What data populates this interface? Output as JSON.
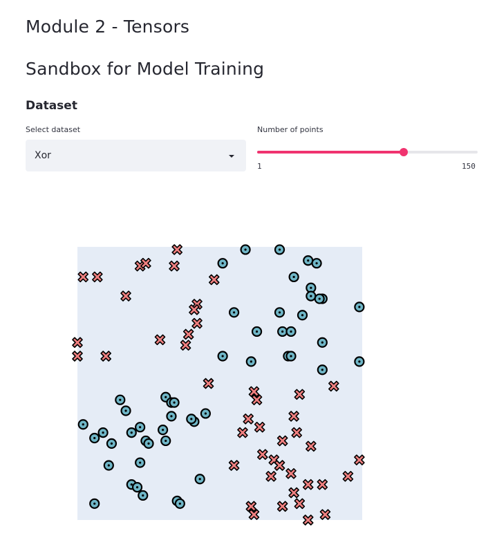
{
  "page": {
    "title": "Module 2 - Tensors",
    "subtitle": "Sandbox for Model Training",
    "section": "Dataset"
  },
  "dataset_select": {
    "label": "Select dataset",
    "value": "Xor"
  },
  "points_slider": {
    "label": "Number of points",
    "min": 1,
    "max": 150,
    "value": 100,
    "min_label": "1",
    "max_label": "150"
  },
  "colors": {
    "accent": "#f0336f",
    "class_cross": "#f08080",
    "class_circle": "#6fb6c7",
    "plot_bg": "#e5ecf6"
  },
  "chart_data": {
    "type": "scatter",
    "title": "",
    "xlabel": "",
    "ylabel": "",
    "xlim": [
      0,
      1
    ],
    "ylim": [
      0,
      1
    ],
    "grid": false,
    "series": [
      {
        "marker": "x",
        "color": "#f08080",
        "points": [
          [
            0.35,
            0.99
          ],
          [
            0.22,
            0.93
          ],
          [
            0.24,
            0.94
          ],
          [
            0.34,
            0.93
          ],
          [
            0.02,
            0.89
          ],
          [
            0.07,
            0.89
          ],
          [
            0.48,
            0.88
          ],
          [
            0.17,
            0.82
          ],
          [
            0.42,
            0.79
          ],
          [
            0.41,
            0.77
          ],
          [
            0.42,
            0.72
          ],
          [
            0.39,
            0.68
          ],
          [
            0.29,
            0.66
          ],
          [
            0.0,
            0.65
          ],
          [
            0.38,
            0.64
          ],
          [
            0.0,
            0.6
          ],
          [
            0.1,
            0.6
          ],
          [
            0.46,
            0.5
          ],
          [
            0.62,
            0.47
          ],
          [
            0.78,
            0.46
          ],
          [
            0.9,
            0.49
          ],
          [
            0.63,
            0.44
          ],
          [
            0.6,
            0.37
          ],
          [
            0.76,
            0.38
          ],
          [
            0.64,
            0.34
          ],
          [
            0.58,
            0.32
          ],
          [
            0.77,
            0.32
          ],
          [
            0.72,
            0.29
          ],
          [
            0.82,
            0.27
          ],
          [
            0.65,
            0.24
          ],
          [
            0.69,
            0.22
          ],
          [
            0.71,
            0.2
          ],
          [
            0.55,
            0.2
          ],
          [
            0.75,
            0.17
          ],
          [
            0.68,
            0.16
          ],
          [
            0.99,
            0.22
          ],
          [
            0.95,
            0.16
          ],
          [
            0.81,
            0.13
          ],
          [
            0.86,
            0.13
          ],
          [
            0.76,
            0.1
          ],
          [
            0.78,
            0.06
          ],
          [
            0.61,
            0.05
          ],
          [
            0.72,
            0.05
          ],
          [
            0.62,
            0.02
          ],
          [
            0.87,
            0.02
          ],
          [
            0.81,
            0.0
          ]
        ]
      },
      {
        "marker": "o",
        "color": "#6fb6c7",
        "points": [
          [
            0.59,
            0.99
          ],
          [
            0.71,
            0.99
          ],
          [
            0.81,
            0.95
          ],
          [
            0.84,
            0.94
          ],
          [
            0.51,
            0.94
          ],
          [
            0.76,
            0.89
          ],
          [
            0.82,
            0.85
          ],
          [
            0.82,
            0.82
          ],
          [
            0.86,
            0.81
          ],
          [
            0.85,
            0.81
          ],
          [
            0.55,
            0.76
          ],
          [
            0.71,
            0.76
          ],
          [
            0.99,
            0.78
          ],
          [
            0.79,
            0.75
          ],
          [
            0.63,
            0.69
          ],
          [
            0.72,
            0.69
          ],
          [
            0.75,
            0.69
          ],
          [
            0.86,
            0.65
          ],
          [
            0.51,
            0.6
          ],
          [
            0.74,
            0.6
          ],
          [
            0.75,
            0.6
          ],
          [
            0.86,
            0.55
          ],
          [
            0.61,
            0.58
          ],
          [
            0.99,
            0.58
          ],
          [
            0.15,
            0.44
          ],
          [
            0.17,
            0.4
          ],
          [
            0.31,
            0.45
          ],
          [
            0.33,
            0.43
          ],
          [
            0.34,
            0.43
          ],
          [
            0.33,
            0.38
          ],
          [
            0.45,
            0.39
          ],
          [
            0.41,
            0.36
          ],
          [
            0.02,
            0.35
          ],
          [
            0.09,
            0.32
          ],
          [
            0.19,
            0.32
          ],
          [
            0.22,
            0.34
          ],
          [
            0.3,
            0.33
          ],
          [
            0.4,
            0.37
          ],
          [
            0.24,
            0.29
          ],
          [
            0.25,
            0.28
          ],
          [
            0.31,
            0.29
          ],
          [
            0.12,
            0.28
          ],
          [
            0.06,
            0.3
          ],
          [
            0.22,
            0.21
          ],
          [
            0.11,
            0.2
          ],
          [
            0.43,
            0.15
          ],
          [
            0.19,
            0.13
          ],
          [
            0.21,
            0.12
          ],
          [
            0.23,
            0.09
          ],
          [
            0.35,
            0.07
          ],
          [
            0.36,
            0.06
          ],
          [
            0.06,
            0.06
          ]
        ]
      }
    ]
  }
}
